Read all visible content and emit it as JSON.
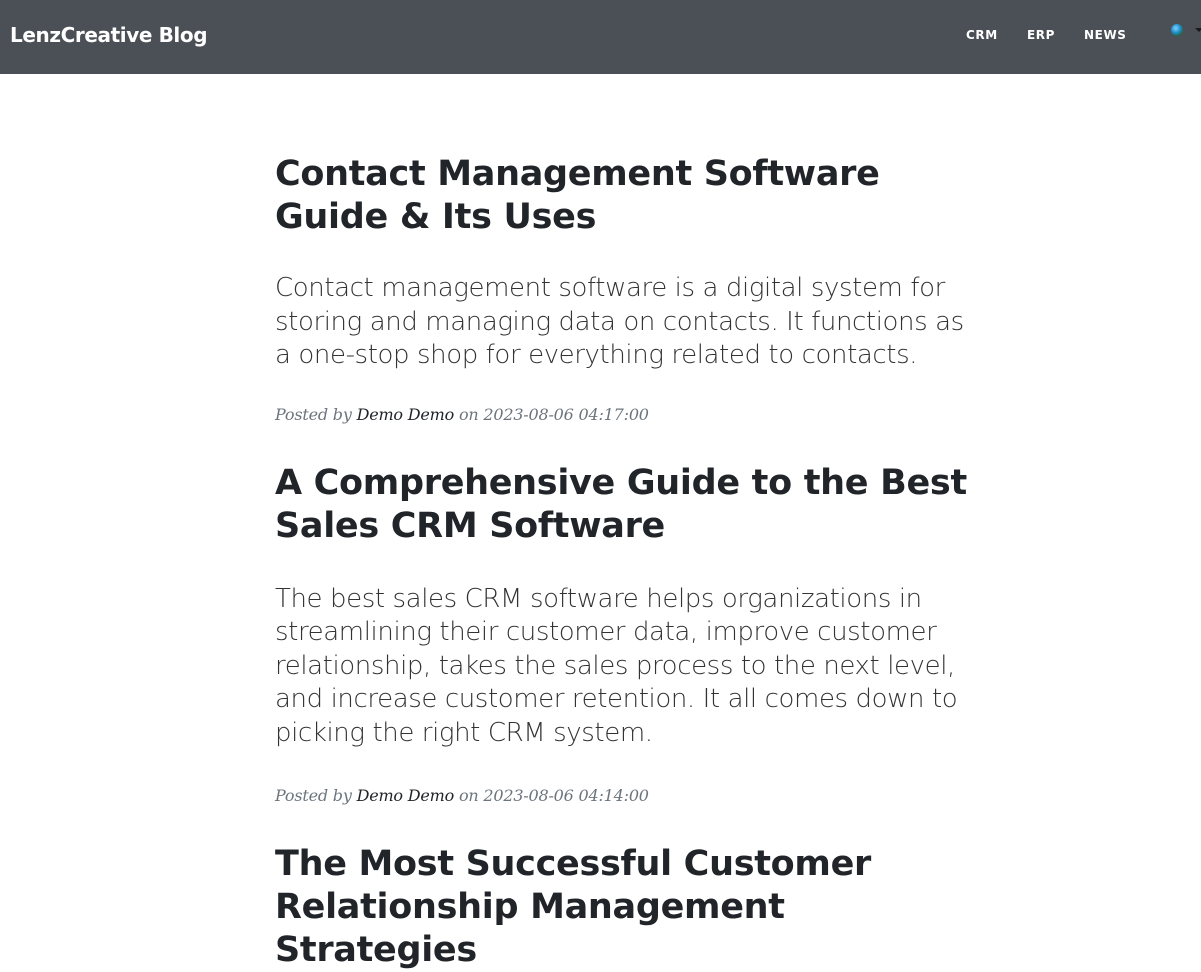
{
  "navbar": {
    "brand": "LenzCreative Blog",
    "links": [
      "CRM",
      "ERP",
      "NEWS"
    ],
    "language_icon": "globe-icon"
  },
  "posts": [
    {
      "title": "Contact Management Software Guide & Its Uses",
      "subtitle": "Contact management software is a digital system for storing and managing data on contacts. It functions as a one-stop shop for everything related to contacts.",
      "posted_by_label": "Posted by",
      "author": "Demo Demo",
      "on_label": "on",
      "date": "2023-08-06 04:17:00"
    },
    {
      "title": "A Comprehensive Guide to the Best Sales CRM Software",
      "subtitle": "The best sales CRM software helps organizations in streamlining their customer data, improve customer relationship, takes the sales process to the next level, and increase customer retention. It all comes down to picking the right CRM system.",
      "posted_by_label": "Posted by",
      "author": "Demo Demo",
      "on_label": "on",
      "date": "2023-08-06 04:14:00"
    },
    {
      "title": "The Most Successful Customer Relationship Management Strategies"
    }
  ]
}
